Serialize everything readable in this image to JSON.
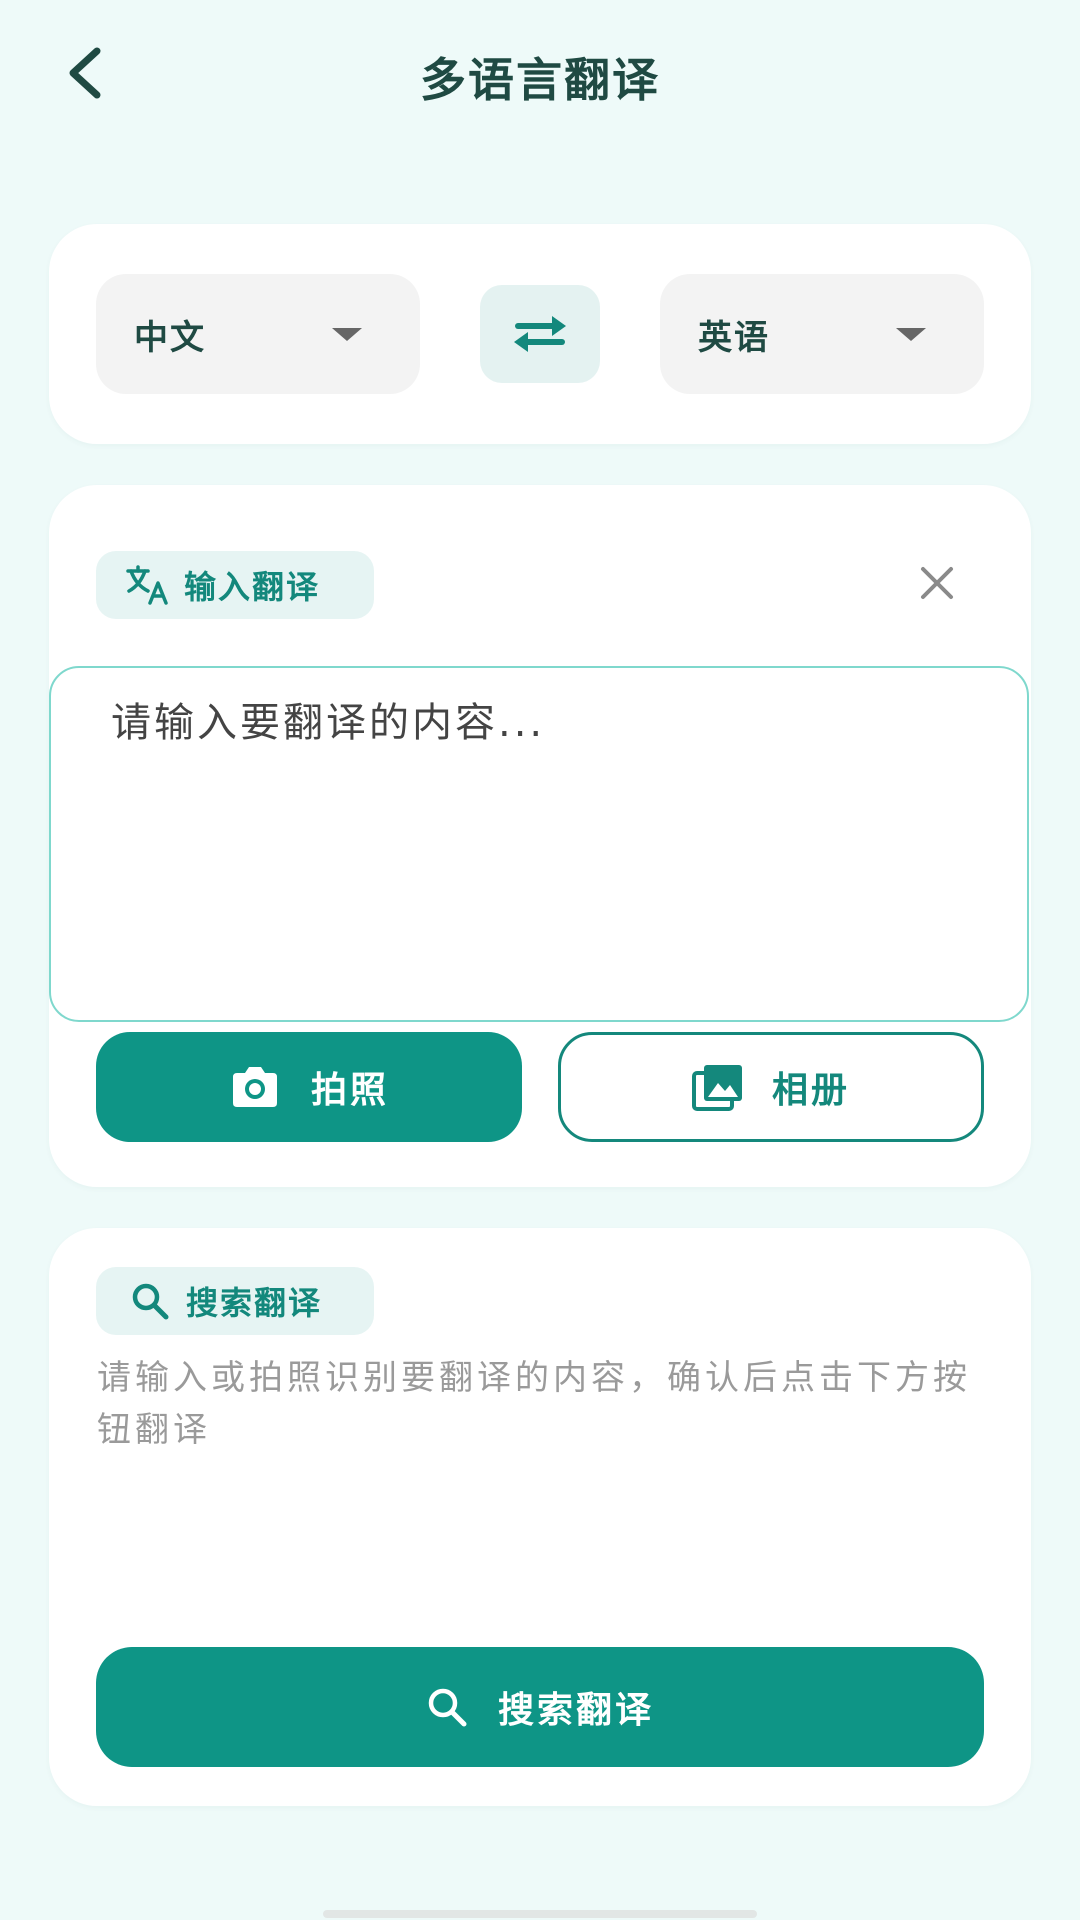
{
  "header": {
    "title": "多语言翻译",
    "back_icon": "chevron-left-icon"
  },
  "language_bar": {
    "source_language": "中文",
    "target_language": "英语",
    "swap_icon": "swap-arrows-icon"
  },
  "input_section": {
    "chip_label": "输入翻译",
    "chip_icon": "translate-icon",
    "clear_icon": "close-icon",
    "placeholder": "请输入要翻译的内容...",
    "value": "",
    "camera_button_label": "拍照",
    "camera_icon": "camera-icon",
    "album_button_label": "相册",
    "album_icon": "photo-library-icon"
  },
  "search_section": {
    "chip_label": "搜索翻译",
    "chip_icon": "search-icon",
    "hint_text": "请输入或拍照识别要翻译的内容，确认后点击下方按钮翻译",
    "search_button_label": "搜索翻译",
    "search_button_icon": "search-icon"
  },
  "colors": {
    "accent": "#0e9586",
    "background": "#eefaf9",
    "card": "#ffffff",
    "title": "#1f4a43"
  }
}
